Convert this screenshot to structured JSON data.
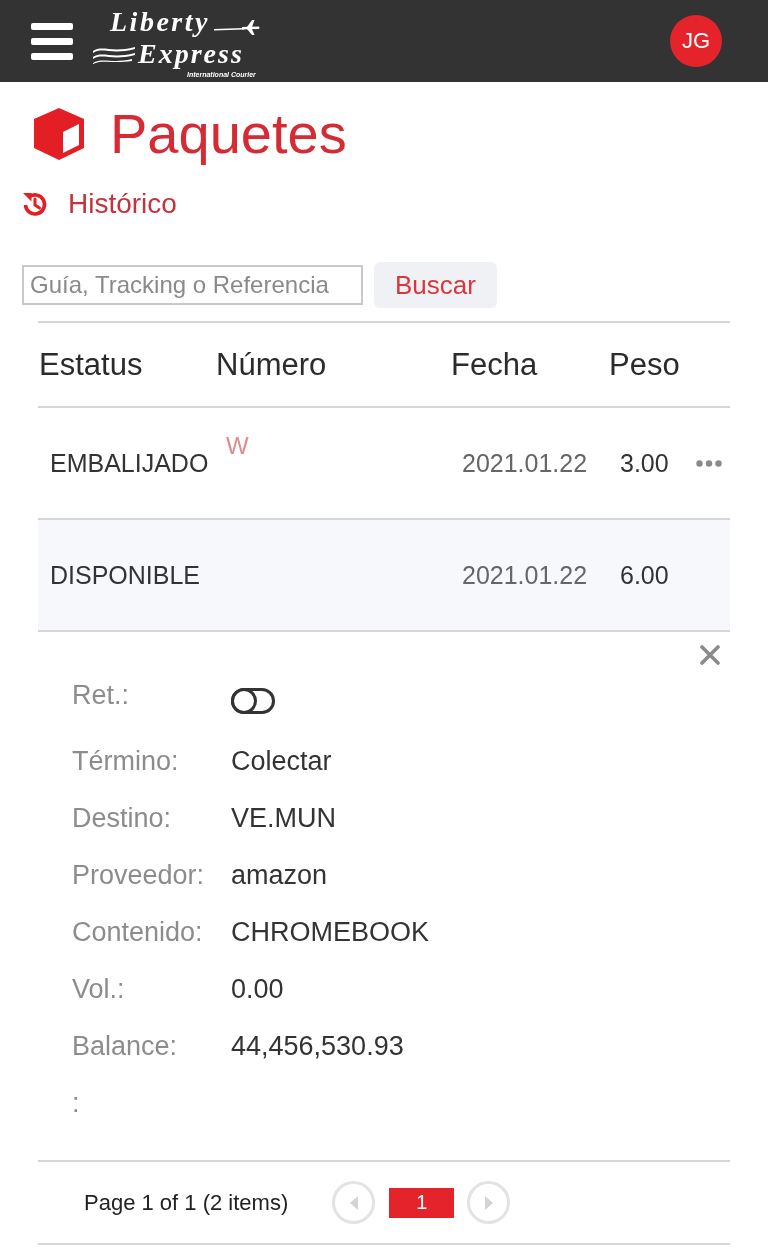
{
  "header": {
    "logo": {
      "line_1": "Liberty",
      "line_2": "Express",
      "tagline": "International Courier"
    },
    "avatar": "JG"
  },
  "page": {
    "title": "Paquetes",
    "history_link": "Histórico"
  },
  "search": {
    "placeholder": "Guía, Tracking o Referencia",
    "button": "Buscar"
  },
  "table": {
    "columns": [
      "Estatus",
      "Número",
      "Fecha",
      "Peso"
    ],
    "rows": [
      {
        "status": "EMBALIJADO",
        "number": "W",
        "date": "2021.01.22",
        "weight": "3.00",
        "expanded": false
      },
      {
        "status": "DISPONIBLE",
        "date": "2021.01.22",
        "weight": "6.00",
        "expanded": true,
        "details": {
          "fields": [
            {
              "kind": "toggle",
              "label": "Ret.:",
              "on": false
            },
            {
              "kind": "text",
              "label": "Término:",
              "value": "Colectar"
            },
            {
              "kind": "text",
              "label": "Destino:",
              "value": "VE.MUN"
            },
            {
              "kind": "text",
              "label": "Proveedor:",
              "value": "amazon"
            },
            {
              "kind": "text",
              "label": "Contenido:",
              "value": "CHROMEBOOK"
            },
            {
              "kind": "text",
              "label": "Vol.:",
              "value": "0.00"
            },
            {
              "kind": "text",
              "label": "Balance:",
              "value": "44,456,530.93"
            },
            {
              "kind": "text",
              "label": ":"
            }
          ]
        }
      }
    ]
  },
  "pager": {
    "summary": "Page 1 of 1 (2 items)",
    "pages": [
      {
        "label": "1",
        "selected": true
      }
    ]
  }
}
